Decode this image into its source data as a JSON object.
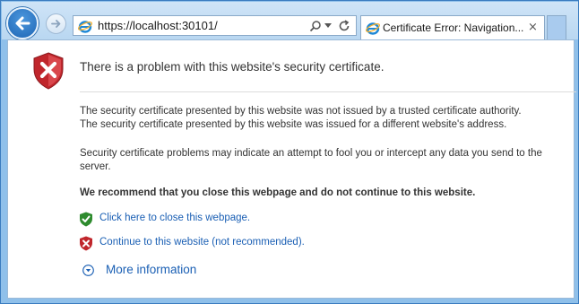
{
  "toolbar": {
    "back_icon": "back-arrow-icon",
    "forward_icon": "forward-arrow-icon",
    "address_url": "https://localhost:30101/",
    "tab_title": "Certificate Error: Navigation...",
    "tab_close": "×"
  },
  "page": {
    "title": "There is a problem with this website's security certificate.",
    "para1": "The security certificate presented by this website was not issued by a trusted certificate authority.",
    "para2": "The security certificate presented by this website was issued for a different website's address.",
    "para3": "Security certificate problems may indicate an attempt to fool you or intercept any data you send to the server.",
    "recommendation": "We recommend that you close this webpage and do not continue to this website.",
    "close_link": "Click here to close this webpage.",
    "continue_link": "Continue to this website (not recommended).",
    "more_info": "More information"
  },
  "colors": {
    "accent": "#1a5fb4",
    "error_red": "#c0262c",
    "safe_green": "#2e8b2e"
  }
}
